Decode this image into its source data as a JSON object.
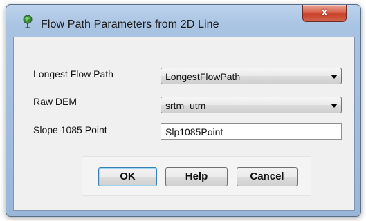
{
  "window": {
    "title": "Flow Path Parameters from 2D Line",
    "close_label": "x"
  },
  "form": {
    "fields": [
      {
        "label": "Longest Flow Path",
        "type": "combo",
        "value": "LongestFlowPath"
      },
      {
        "label": "Raw DEM",
        "type": "combo",
        "value": "srtm_utm"
      },
      {
        "label": "Slope 1085 Point",
        "type": "text",
        "value": "Slp1085Point"
      }
    ]
  },
  "buttons": {
    "ok": "OK",
    "help": "Help",
    "cancel": "Cancel"
  },
  "icons": {
    "title": "globe-pin-icon",
    "close": "close-icon",
    "dropdown": "chevron-down-icon"
  },
  "colors": {
    "titlebar": "#a9c3e2",
    "close": "#c8402a",
    "client": "#f0f0f0"
  }
}
